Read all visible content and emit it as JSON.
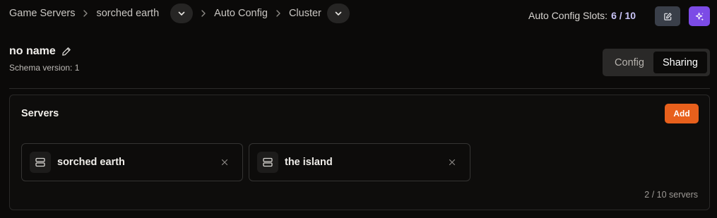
{
  "breadcrumb": {
    "items": [
      "Game Servers",
      "sorched earth",
      "Auto Config",
      "Cluster"
    ]
  },
  "header": {
    "slots_label": "Auto Config Slots:",
    "slots_count": "6 / 10"
  },
  "config": {
    "title": "no name",
    "schema_version": "Schema version: 1"
  },
  "tabs": [
    {
      "label": "Config",
      "active": false
    },
    {
      "label": "Sharing",
      "active": true
    }
  ],
  "servers_panel": {
    "title": "Servers",
    "add_label": "Add",
    "servers": [
      {
        "name": "sorched earth"
      },
      {
        "name": "the island"
      }
    ],
    "count_text": "2 / 10 servers"
  },
  "colors": {
    "accent_orange": "#e8601c",
    "accent_purple": "#7c4be6",
    "background": "#0b0a09"
  },
  "icons": {
    "edit": "pencil-square-icon",
    "ai": "sparkle-icon",
    "title_edit": "pencil-icon",
    "server": "server-icon",
    "remove": "close-icon"
  }
}
